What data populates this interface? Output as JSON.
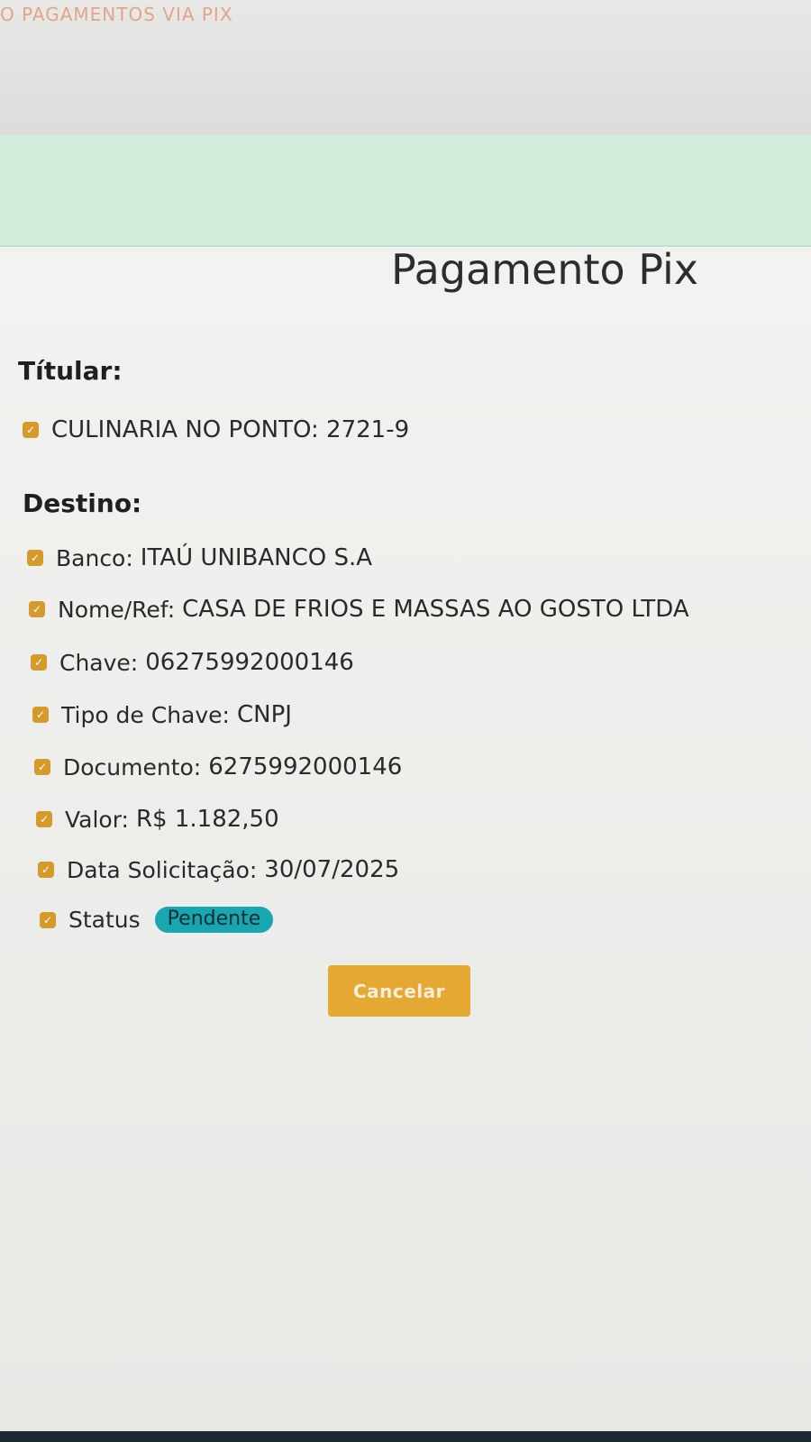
{
  "header": {
    "title": "O PAGAMENTOS VIA PIX"
  },
  "page": {
    "title": "Pagamento Pix"
  },
  "titular": {
    "label": "Títular:",
    "value": "CULINARIA NO PONTO: 2721-9"
  },
  "destino": {
    "label": "Destino:",
    "fields": [
      {
        "label": "Banco:",
        "value": "ITAÚ UNIBANCO S.A"
      },
      {
        "label": "Nome/Ref:",
        "value": "CASA DE FRIOS E MASSAS AO GOSTO LTDA"
      },
      {
        "label": "Chave:",
        "value": "06275992000146"
      },
      {
        "label": "Tipo de Chave:",
        "value": "CNPJ"
      },
      {
        "label": "Documento:",
        "value": "6275992000146"
      },
      {
        "label": "Valor:",
        "value": "R$ 1.182,50"
      },
      {
        "label": "Data Solicitação:",
        "value": "30/07/2025"
      }
    ],
    "status": {
      "label": "Status",
      "value": "Pendente"
    }
  },
  "actions": {
    "cancel_label": "Cancelar"
  },
  "colors": {
    "accent": "#e5a833",
    "check": "#d49a2b",
    "status_badge": "#18a6b0",
    "success_bar": "#d3ecdc",
    "header_text": "#e3a48a"
  },
  "icons": {
    "check": "check-square-icon"
  }
}
